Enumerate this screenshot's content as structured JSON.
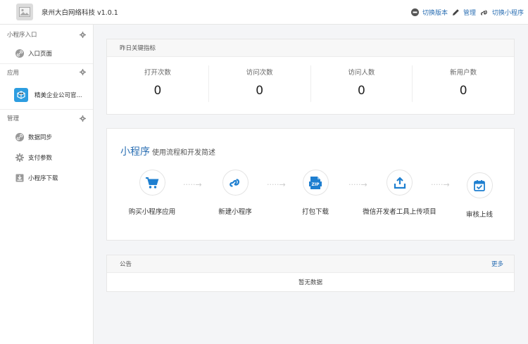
{
  "header": {
    "title": "泉州大白网络科技 v1.0.1",
    "actions": [
      {
        "label": "切换版本",
        "icon": "switch-version-icon"
      },
      {
        "label": "管理",
        "icon": "pencil-icon"
      },
      {
        "label": "切换小程序",
        "icon": "miniprogram-icon"
      }
    ]
  },
  "sidebar": {
    "sections": [
      {
        "title": "小程序入口",
        "items": [
          {
            "label": "入口页面",
            "icon": "link-icon"
          }
        ]
      },
      {
        "title": "应用",
        "items": [
          {
            "label": "精美企业公司官...",
            "icon": "app-cube-icon"
          }
        ]
      },
      {
        "title": "管理",
        "items": [
          {
            "label": "数据同步",
            "icon": "link-icon"
          },
          {
            "label": "支付参数",
            "icon": "gear-icon"
          },
          {
            "label": "小程序下载",
            "icon": "download-icon"
          }
        ]
      }
    ]
  },
  "stats": {
    "title": "昨日关键指标",
    "items": [
      {
        "label": "打开次数",
        "value": "0"
      },
      {
        "label": "访问次数",
        "value": "0"
      },
      {
        "label": "访问人数",
        "value": "0"
      },
      {
        "label": "新用户数",
        "value": "0"
      }
    ]
  },
  "flow": {
    "title_main": "小程序",
    "title_sub": "使用流程和开发简述",
    "steps": [
      {
        "label": "购买小程序应用",
        "icon": "cart-icon"
      },
      {
        "label": "新建小程序",
        "icon": "miniprogram-icon"
      },
      {
        "label": "打包下载",
        "icon": "zip-icon"
      },
      {
        "label": "微信开发者工具上传项目",
        "icon": "upload-icon"
      },
      {
        "label": "审核上线",
        "icon": "calendar-check-icon"
      }
    ],
    "arrow": "·····→"
  },
  "notice": {
    "title": "公告",
    "more": "更多",
    "empty": "暂无数据"
  },
  "colors": {
    "accent": "#2b6fb3",
    "icon_blue": "#1e7fd0"
  }
}
